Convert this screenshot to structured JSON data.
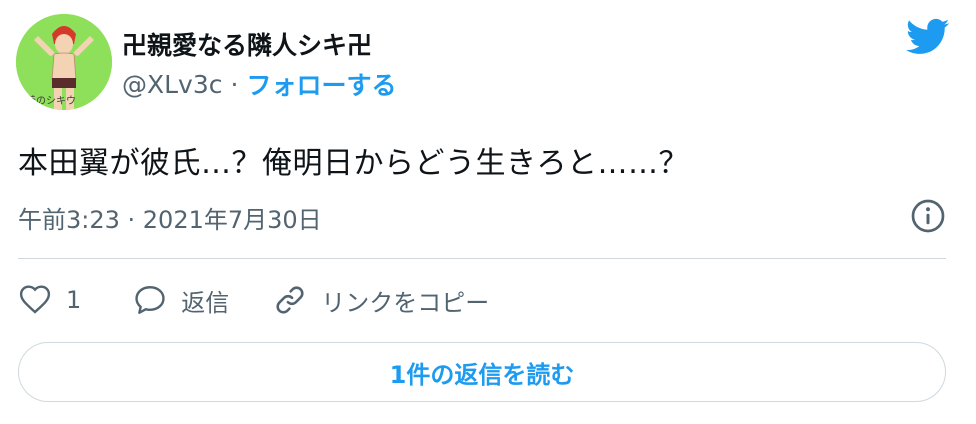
{
  "author": {
    "display_name": "卍親愛なる隣人シキ卍",
    "handle": "@XLv3c",
    "separator": "·",
    "follow_label": "フォローする",
    "avatar_caption": "着のシキウ"
  },
  "tweet": {
    "text": "本田翼が彼氏…？俺明日からどう生きろと……？",
    "timestamp": "午前3:23 · 2021年7月30日"
  },
  "actions": {
    "like_count": "1",
    "reply_label": "返信",
    "copy_link_label": "リンクをコピー"
  },
  "read_replies_label": "1件の返信を読む",
  "colors": {
    "accent": "#1d9bf0",
    "text_primary": "#0f1419",
    "text_secondary": "#536471",
    "border": "#cfd9de",
    "avatar_bg": "#8ee05a"
  },
  "icons": [
    "twitter-bird-icon",
    "info-icon",
    "heart-icon",
    "reply-icon",
    "link-icon"
  ]
}
